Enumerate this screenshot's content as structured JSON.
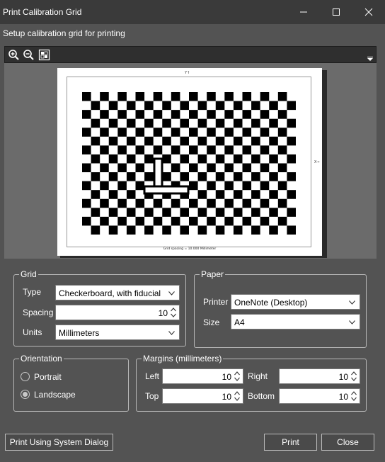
{
  "window": {
    "title": "Print Calibration Grid",
    "subtitle": "Setup calibration grid for printing"
  },
  "toolbar": {
    "icons": [
      "zoom-in-icon",
      "zoom-out-icon",
      "fit-page-icon"
    ]
  },
  "preview": {
    "y_axis_label": "Y↑",
    "x_axis_label": "X→",
    "caption": "Grid spacing = 10.000 Millimeter",
    "checker_cols": 24,
    "checker_rows": 16,
    "fiducial": true
  },
  "grid_group": {
    "title": "Grid",
    "type_label": "Type",
    "type_value": "Checkerboard, with fiducial",
    "spacing_label": "Spacing",
    "spacing_value": "10",
    "units_label": "Units",
    "units_value": "Millimeters"
  },
  "paper_group": {
    "title": "Paper",
    "printer_label": "Printer",
    "printer_value": "OneNote (Desktop)",
    "size_label": "Size",
    "size_value": "A4"
  },
  "orientation_group": {
    "title": "Orientation",
    "options": [
      {
        "label": "Portrait",
        "selected": false
      },
      {
        "label": "Landscape",
        "selected": true
      }
    ]
  },
  "margins_group": {
    "title": "Margins (millimeters)",
    "left_label": "Left",
    "left_value": "10",
    "right_label": "Right",
    "right_value": "10",
    "top_label": "Top",
    "top_value": "10",
    "bottom_label": "Bottom",
    "bottom_value": "10"
  },
  "buttons": {
    "system_dialog": "Print Using System Dialog",
    "print": "Print",
    "close": "Close"
  },
  "colors": {
    "background": "#535353",
    "titlebar": "#3a3a3a",
    "preview_bg": "#6b6b6b"
  }
}
